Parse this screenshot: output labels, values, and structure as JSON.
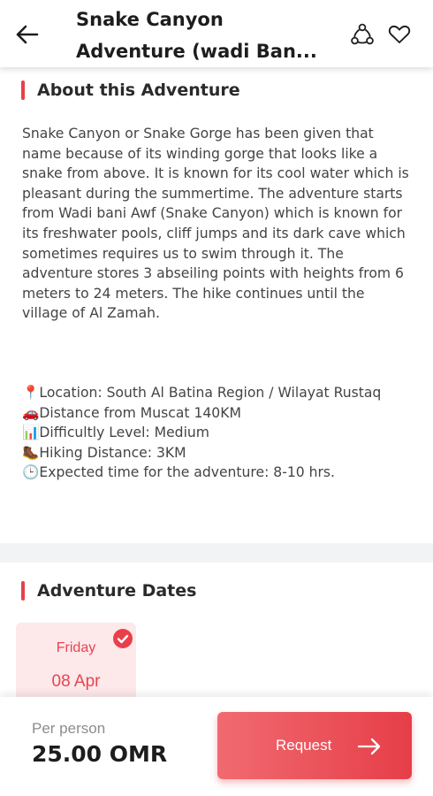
{
  "header": {
    "title_line1": "Snake Canyon",
    "title_line2": "Adventure (wadi Ban...",
    "back_icon": "arrow-left-icon",
    "share_icon": "share-icon",
    "favorite_icon": "heart-icon"
  },
  "about": {
    "heading": "About this Adventure",
    "description": "Snake Canyon or Snake Gorge has been given that name because of its winding gorge that looks like a snake from above. It is known for its cool water which is pleasant during the summertime. The adventure starts from Wadi bani Awf (Snake Canyon) which is known for its freshwater pools, cliff jumps and its dark cave which sometimes requires us to swim through it. The adventure stores 3 abseiling points with heights from 6 meters to 24 meters. The hike continues until the village of Al Zamah.",
    "details": [
      "📍Location: South Al Batina Region / Wilayat Rustaq",
      "🚗Distance from Muscat 140KM",
      "📊Difficultly Level: Medium",
      "🥾Hiking Distance: 3KM",
      "🕒Expected time for the adventure: 8-10 hrs."
    ]
  },
  "dates": {
    "heading": "Adventure Dates",
    "items": [
      {
        "day": "Friday",
        "date": "08 Apr",
        "selected": true
      }
    ]
  },
  "footer": {
    "per_person_label": "Per person",
    "price": "25.00 OMR",
    "request_label": "Request"
  },
  "colors": {
    "accent": "#e8404a",
    "card_bg": "#fde8ea"
  }
}
